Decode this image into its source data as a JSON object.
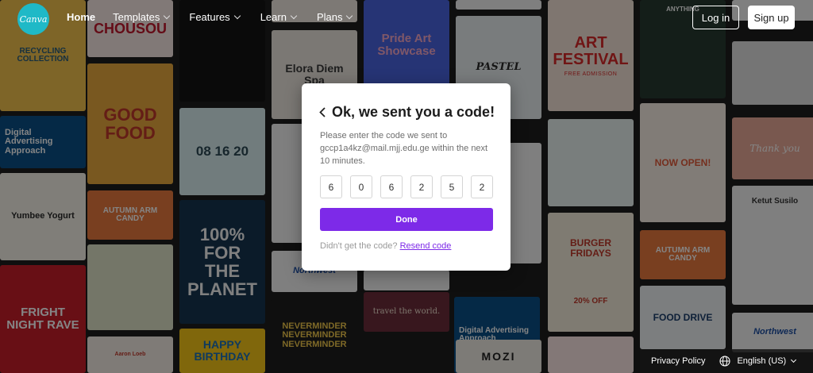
{
  "nav": {
    "logo_text": "Canva",
    "items": [
      {
        "label": "Home"
      },
      {
        "label": "Templates"
      },
      {
        "label": "Features"
      },
      {
        "label": "Learn"
      },
      {
        "label": "Plans"
      }
    ],
    "login_label": "Log in",
    "signup_label": "Sign up"
  },
  "modal": {
    "title": "Ok, we sent you a code!",
    "description": "Please enter the code we sent to gccp1a4kz@mail.mjj.edu.ge within the next 10 minutes.",
    "code_digits": [
      "6",
      "0",
      "6",
      "2",
      "5",
      "2"
    ],
    "done_label": "Done",
    "resend_prefix": "Didn't get the code?",
    "resend_link": "Resend code"
  },
  "footer": {
    "privacy_label": "Privacy Policy",
    "language_label": "English (US)"
  },
  "background_tiles": {
    "col1": [
      "RECYCLING COLLECTION",
      "Digital Advertising Approach",
      "Yumbee Yogurt",
      "FRIGHT NIGHT RAVE"
    ],
    "col2": [
      "CHOUSOU",
      "GOOD FOOD",
      "AUTUMN ARM CANDY",
      "Aaron Loeb"
    ],
    "col3": [
      "08 16 20",
      "100% FOR THE PLANET",
      "HAPPY BIRTHDAY"
    ],
    "col4": [
      "Elora Diem Spa",
      "Northwest",
      "NEVERMINDER NEVERMINDER NEVERMINDER"
    ],
    "col5": [
      "Pride Art Showcase",
      "travel the world.",
      "Digital Advertising Approach"
    ],
    "col6": [
      "PASTEL",
      "BURGER FRIDAYS",
      "20% OFF",
      "MOZI"
    ],
    "col7": [
      "ART FESTIVAL",
      "FREE ADMISSION"
    ],
    "col8": [
      "ANYTHING",
      "NOW OPEN!",
      "AUTUMN ARM CANDY",
      "FOOD DRIVE"
    ],
    "col9": [
      "Thank you",
      "Ketut Susilo",
      "Northwest"
    ]
  },
  "colors": {
    "accent": "#7d2ae8",
    "logo": "#1fb9c7"
  }
}
